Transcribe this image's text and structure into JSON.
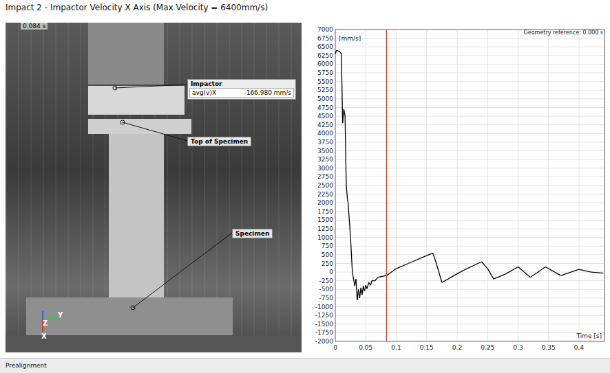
{
  "title": "Impact 2 - Impactor Velocity X Axis (Max Velocity = 6400mm/s)",
  "viewport": {
    "timestamp": "0.084 s",
    "impactor_label": {
      "title": "Impactor",
      "quantity": "avg(v)X",
      "value": "-166.980 mm/s"
    },
    "point_labels": [
      "Top of Specimen",
      "Specimen"
    ],
    "axes": [
      "Y",
      "Z",
      "X"
    ]
  },
  "chart": {
    "unit": "[mm/s]",
    "x_label": "Time [s]",
    "reference": "Geometry reference: 0.000 s",
    "y_ticks": [
      "7000",
      "6750",
      "6500",
      "6250",
      "6000",
      "5750",
      "5500",
      "5250",
      "5000",
      "4750",
      "4500",
      "4250",
      "4000",
      "3750",
      "3500",
      "3250",
      "3000",
      "2750",
      "2500",
      "2250",
      "2000",
      "1750",
      "1500",
      "1250",
      "1000",
      "750",
      "500",
      "250",
      "0",
      "-250",
      "-500",
      "-750",
      "-1000",
      "-1250",
      "-1500",
      "-1750",
      "-2000"
    ],
    "x_ticks": [
      "0",
      "0.05",
      "0.1",
      "0.15",
      "0.2",
      "0.25",
      "0.3",
      "0.35",
      "0.4"
    ],
    "cursor_time": 0.084,
    "series": [
      {
        "times": [
          0,
          0.002,
          0.005,
          0.008,
          0.01,
          0.012,
          0.014,
          0.016,
          0.018,
          0.02,
          0.021,
          0.025,
          0.028,
          0.032,
          0.034,
          0.036,
          0.038,
          0.04,
          0.042,
          0.044,
          0.046,
          0.048,
          0.05,
          0.052,
          0.055,
          0.058,
          0.06,
          0.065,
          0.07,
          0.084,
          0.1,
          0.12,
          0.14,
          0.16,
          0.165,
          0.175,
          0.19,
          0.21,
          0.24,
          0.25,
          0.26,
          0.28,
          0.3,
          0.31,
          0.32,
          0.345,
          0.36,
          0.37,
          0.4,
          0.42,
          0.44
        ],
        "values": [
          6300,
          6400,
          6380,
          6350,
          6300,
          4300,
          4700,
          4500,
          2500,
          2100,
          2000,
          1000,
          0,
          -400,
          -200,
          -800,
          -500,
          -750,
          -450,
          -650,
          -400,
          -550,
          -380,
          -480,
          -300,
          -380,
          -250,
          -250,
          -150,
          -100,
          100,
          250,
          400,
          550,
          300,
          -300,
          -150,
          50,
          300,
          100,
          -200,
          -50,
          150,
          0,
          -150,
          150,
          0,
          -100,
          80,
          0,
          -30
        ]
      }
    ]
  },
  "status_bar": "Prealignment"
}
